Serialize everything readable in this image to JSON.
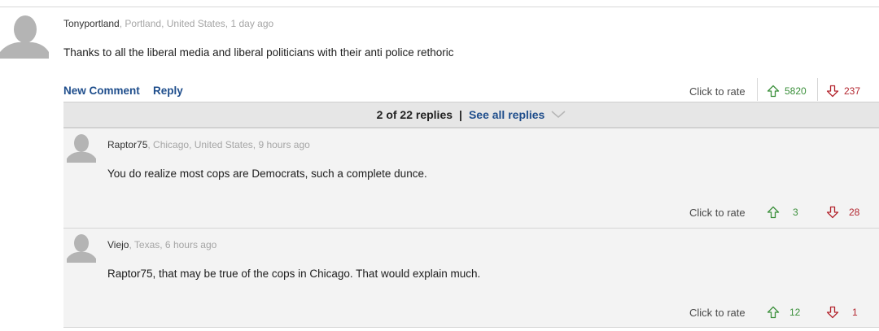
{
  "comment": {
    "username": "Tonyportland",
    "meta": ", Portland, United States, 1 day ago",
    "text": "Thanks to all the liberal media and liberal politicians with their anti police rethoric",
    "new_comment_label": "New Comment",
    "reply_label": "Reply",
    "rate_label": "Click to rate",
    "up_count": "5820",
    "down_count": "237"
  },
  "replies_bar": {
    "count_label": "2 of 22 replies",
    "separator": "|",
    "see_all_label": "See all replies"
  },
  "replies": [
    {
      "username": "Raptor75",
      "meta": ", Chicago, United States, 9 hours ago",
      "text": "You do realize most cops are Democrats, such a complete dunce.",
      "rate_label": "Click to rate",
      "up_count": "3",
      "down_count": "28"
    },
    {
      "username": "Viejo",
      "meta": ", Texas, 6 hours ago",
      "text": "Raptor75, that may be true of the cops in Chicago. That would explain much.",
      "rate_label": "Click to rate",
      "up_count": "12",
      "down_count": "1"
    }
  ],
  "colors": {
    "link": "#1f4e8c",
    "up": "#3a8f3a",
    "down": "#b3262f",
    "reply_bg": "#f3f3f3",
    "bar_bg": "#e6e6e6"
  }
}
